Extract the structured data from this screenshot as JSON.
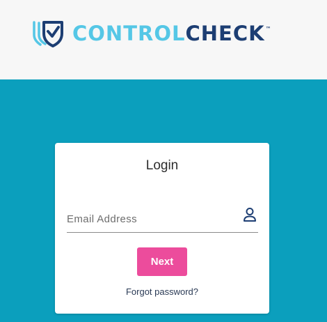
{
  "brand": {
    "word_light": "CONTROL",
    "word_dark": "CHECK",
    "trademark": "™",
    "colors": {
      "light_blue": "#55c7e6",
      "dark_blue": "#1d3e73"
    },
    "logo_icon": "shield-check-icon"
  },
  "page": {
    "background": "#0b9fbd",
    "header_background": "#f7f7f7"
  },
  "login": {
    "title": "Login",
    "email_placeholder": "Email Address",
    "email_value": "",
    "user_icon": "user-icon",
    "next_label": "Next",
    "next_color": "#ec4c9c",
    "forgot_label": "Forgot password?"
  }
}
